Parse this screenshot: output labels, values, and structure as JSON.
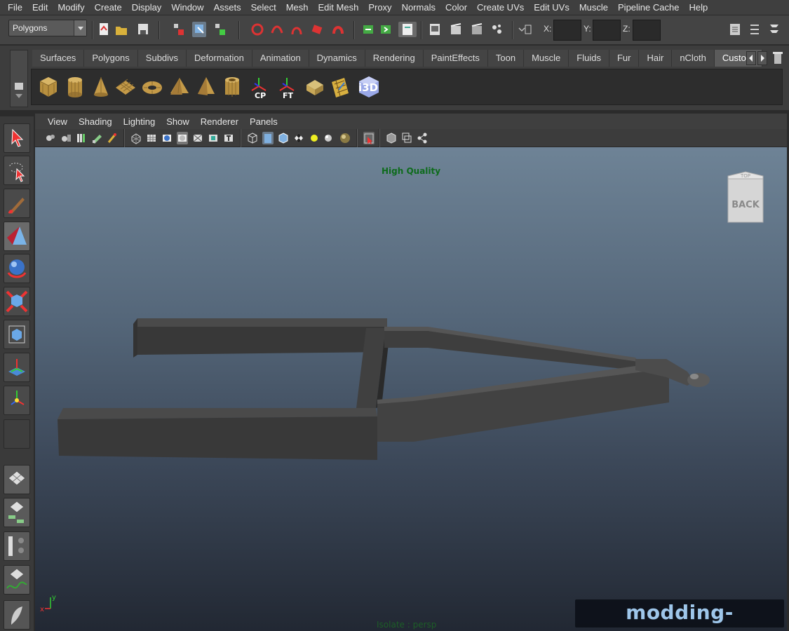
{
  "menu": [
    "File",
    "Edit",
    "Modify",
    "Create",
    "Display",
    "Window",
    "Assets",
    "Select",
    "Mesh",
    "Edit Mesh",
    "Proxy",
    "Normals",
    "Color",
    "Create UVs",
    "Edit UVs",
    "Muscle",
    "Pipeline Cache",
    "Help"
  ],
  "statusline": {
    "mode": "Polygons",
    "coord_labels": [
      "X:",
      "Y:",
      "Z:"
    ]
  },
  "shelf": {
    "tabs": [
      "Surfaces",
      "Polygons",
      "Subdivs",
      "Deformation",
      "Animation",
      "Dynamics",
      "Rendering",
      "PaintEffects",
      "Toon",
      "Muscle",
      "Fluids",
      "Fur",
      "Hair",
      "nCloth",
      "Custom"
    ],
    "active_tab": "Custom",
    "icons": [
      "poly-cube-icon",
      "poly-cylinder-icon",
      "poly-cone-icon",
      "poly-plane-icon",
      "poly-torus-icon",
      "poly-prism-icon",
      "poly-pyramid-icon",
      "poly-pipe-icon",
      "center-pivot-icon",
      "freeze-transform-icon",
      "box-icon",
      "uv-grid-icon",
      "i3d-export-icon"
    ],
    "cp_label": "CP",
    "ft_label": "FT",
    "i3d_label": "i3D"
  },
  "panel": {
    "menu": [
      "View",
      "Shading",
      "Lighting",
      "Show",
      "Renderer",
      "Panels"
    ]
  },
  "viewport": {
    "hud_top": "High Quality",
    "hud_bottom": "Isolate : persp",
    "viewcube_face": "BACK",
    "viewcube_top": "TOP",
    "axis_y": "y",
    "axis_x": "x"
  },
  "watermark": "modding-welt.com"
}
